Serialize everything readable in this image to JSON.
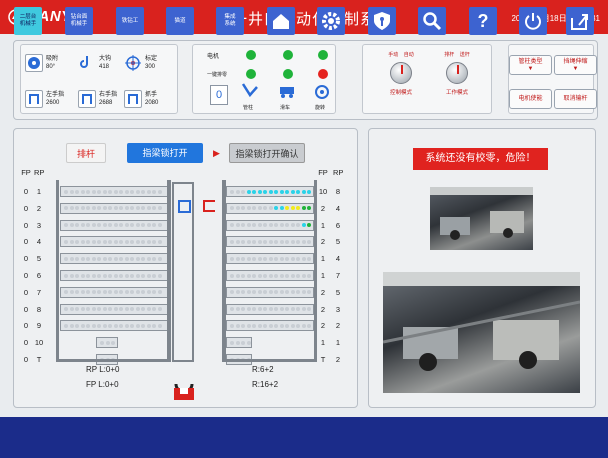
{
  "header": {
    "brand": "SANY",
    "title": "三一井口自动化控制系统",
    "datetime": "2019年3月18日  15:31:31",
    "bg": "#d9221e"
  },
  "status": {
    "tiles": [
      {
        "icon": "fan-icon",
        "label": "吸附\n80°"
      },
      {
        "icon": "hook-icon",
        "label": "大钩\n418"
      },
      {
        "icon": "target-icon",
        "label": "标定\n300"
      },
      {
        "icon": "clamp-left-icon",
        "label": "左手指\n2600"
      },
      {
        "icon": "clamp-right-icon",
        "label": "右手指\n2688"
      },
      {
        "icon": "gripper-icon",
        "label": "抓手\n2080"
      }
    ],
    "lamp_rows": [
      {
        "label": "电机"
      },
      {
        "label": "一键排零"
      }
    ],
    "count_box": "0",
    "mini_labels": [
      "管柱",
      "滑车",
      "旋转"
    ]
  },
  "selectors": [
    {
      "top": "手动    自动",
      "bottom": "控制模式"
    },
    {
      "top": "排杆    送杆",
      "bottom": "工作模式"
    }
  ],
  "side_buttons": [
    "管柱类型",
    "挡绳伸缩",
    "电机使能",
    "取消输杆"
  ],
  "fingerboard": {
    "left_header": [
      "FP",
      "RP"
    ],
    "right_header": [
      "FP",
      "RP"
    ],
    "left_rows": [
      [
        "0",
        "1"
      ],
      [
        "0",
        "2"
      ],
      [
        "0",
        "3"
      ],
      [
        "0",
        "4"
      ],
      [
        "0",
        "5"
      ],
      [
        "0",
        "6"
      ],
      [
        "0",
        "7"
      ],
      [
        "0",
        "8"
      ],
      [
        "0",
        "9"
      ],
      [
        "0",
        "10"
      ],
      [
        "0",
        "T"
      ]
    ],
    "right_rows": [
      [
        "10",
        "8"
      ],
      [
        "2",
        "4"
      ],
      [
        "1",
        "6"
      ],
      [
        "2",
        "5"
      ],
      [
        "1",
        "4"
      ],
      [
        "1",
        "7"
      ],
      [
        "2",
        "5"
      ],
      [
        "2",
        "3"
      ],
      [
        "2",
        "2"
      ],
      [
        "1",
        "1"
      ],
      [
        "T",
        "2"
      ]
    ],
    "buttons": {
      "discharge": "排杆",
      "open": "指梁锁打开",
      "confirm": "指梁锁打开确认"
    },
    "readouts": {
      "rp": "RP    L:0+0",
      "fp": "FP    L:0+0",
      "r1": "R:6+2",
      "r2": "R:16+2"
    }
  },
  "alert": "系统还没有校零，危险！",
  "footer": {
    "items": [
      {
        "label": "二层台\n机械手",
        "icon": ""
      },
      {
        "label": "钻台面\n机械手",
        "icon": ""
      },
      {
        "label": "铁钻工",
        "icon": ""
      },
      {
        "label": "猫道",
        "icon": ""
      },
      {
        "label": "集成\n系统",
        "icon": ""
      },
      {
        "label": "",
        "icon": "home-icon"
      },
      {
        "label": "",
        "icon": "settings-icon"
      },
      {
        "label": "",
        "icon": "shield-key-icon"
      },
      {
        "label": "",
        "icon": "search-icon"
      },
      {
        "label": "",
        "icon": "help-icon"
      },
      {
        "label": "",
        "icon": "power-icon"
      },
      {
        "label": "",
        "icon": "exit-icon"
      }
    ]
  }
}
